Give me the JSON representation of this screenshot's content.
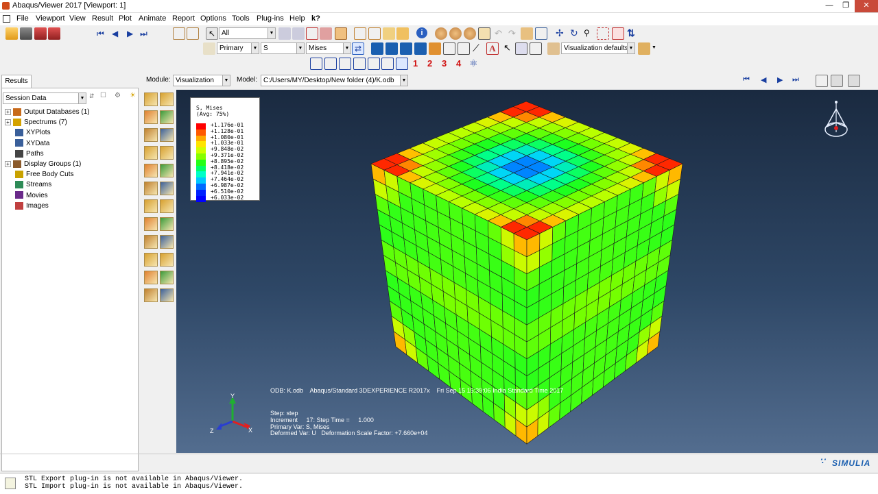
{
  "window": {
    "title": "Abaqus/Viewer 2017 [Viewport: 1]"
  },
  "menu": [
    "File",
    "Viewport",
    "View",
    "Result",
    "Plot",
    "Animate",
    "Report",
    "Options",
    "Tools",
    "Plug-ins",
    "Help"
  ],
  "help_cursor": "k?",
  "toolbar": {
    "selection_filter": "All",
    "field_primary": "Primary",
    "field_var": "S",
    "field_invariant": "Mises",
    "view_defaults": "Visualization defaults",
    "viewport_numbers": [
      "1",
      "2",
      "3",
      "4"
    ]
  },
  "context": {
    "module_label": "Module:",
    "module_value": "Visualization",
    "model_label": "Model:",
    "model_value": "C:/Users/MY/Desktop/New folder (4)/K.odb"
  },
  "left_panel": {
    "tab": "Results",
    "session_combo": "Session Data",
    "tree": [
      {
        "label": "Output Databases (1)",
        "expand": "+",
        "icon": "odb-icon",
        "color": "#c86a1a"
      },
      {
        "label": "Spectrums (7)",
        "expand": "+",
        "icon": "spectrum-icon",
        "color": "#d4a200"
      },
      {
        "label": "XYPlots",
        "expand": "",
        "icon": "xyplot-icon",
        "color": "#3a5f9a"
      },
      {
        "label": "XYData",
        "expand": "",
        "icon": "xydata-icon",
        "color": "#3a5f9a"
      },
      {
        "label": "Paths",
        "expand": "",
        "icon": "path-icon",
        "color": "#444444"
      },
      {
        "label": "Display Groups (1)",
        "expand": "+",
        "icon": "display-group-icon",
        "color": "#8b5a2b"
      },
      {
        "label": "Free Body Cuts",
        "expand": "",
        "icon": "free-body-cut-icon",
        "color": "#c9a200"
      },
      {
        "label": "Streams",
        "expand": "",
        "icon": "streams-icon",
        "color": "#2e8b57"
      },
      {
        "label": "Movies",
        "expand": "",
        "icon": "movies-icon",
        "color": "#6a2a8a"
      },
      {
        "label": "Images",
        "expand": "",
        "icon": "images-icon",
        "color": "#c04040"
      }
    ]
  },
  "legend": {
    "title": "S, Mises",
    "subtitle": "(Avg: 75%)",
    "levels": [
      "+1.176e-01",
      "+1.128e-01",
      "+1.080e-01",
      "+1.033e-01",
      "+9.848e-02",
      "+9.371e-02",
      "+8.895e-02",
      "+8.418e-02",
      "+7.941e-02",
      "+7.464e-02",
      "+6.987e-02",
      "+6.510e-02",
      "+6.033e-02"
    ],
    "colors": [
      "#ff0000",
      "#ff5a00",
      "#ffaa00",
      "#ffe400",
      "#cfff00",
      "#86ff00",
      "#24ff18",
      "#00ff6a",
      "#00ffc8",
      "#00c8ff",
      "#006aff",
      "#0022ff",
      "#0000ff"
    ]
  },
  "viewport_info": {
    "odb_line": "ODB: K.odb    Abaqus/Standard 3DEXPERIENCE R2017x    Fri Sep 15 15:39:06 India Standard Time 2017",
    "step": "Step: step",
    "increment": "Increment     17: Step Time =     1.000",
    "primary": "Primary Var: S, Mises",
    "deformed": "Deformed Var: U   Deformation Scale Factor: +7.660e+04"
  },
  "triad": {
    "x": "X",
    "y": "Y",
    "z": "Z"
  },
  "brand": "SIMULIA",
  "messages": [
    "STL Export plug-in is not available in Abaqus/Viewer.",
    "STL Import plug-in is not available in Abaqus/Viewer."
  ]
}
